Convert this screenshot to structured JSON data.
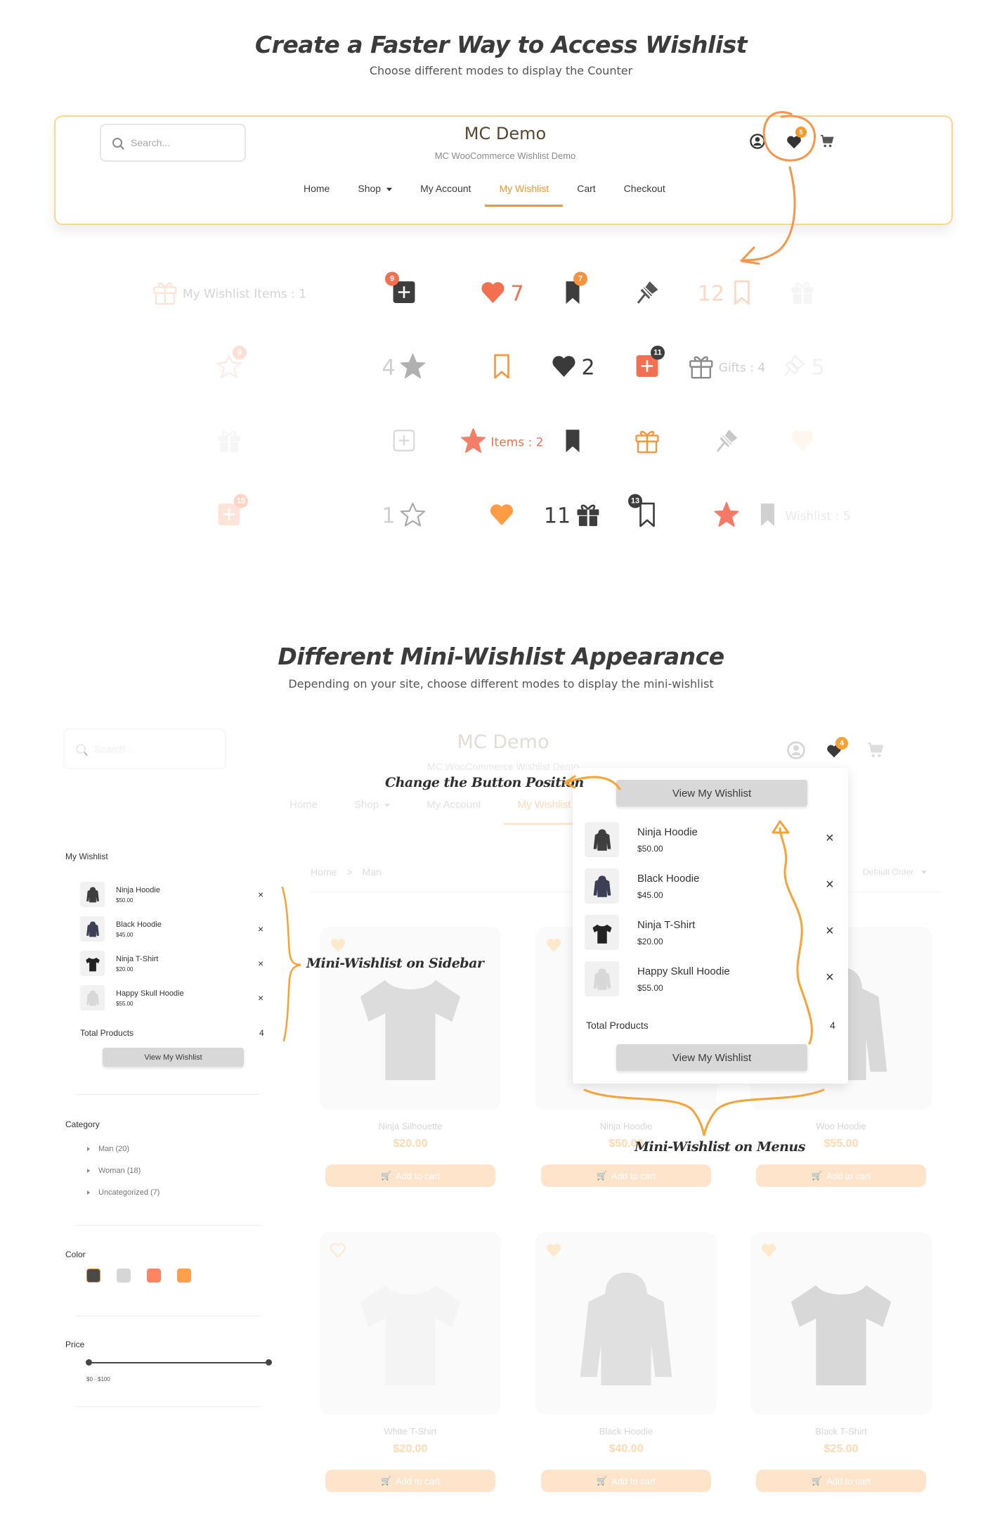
{
  "section1": {
    "title": "Create a Faster Way to Access Wishlist",
    "subtitle": "Choose different modes to display the Counter",
    "header_demo": {
      "search_placeholder": "Search...",
      "brand": "MC Demo",
      "tagline": "MC WooCommerce Wishlist Demo",
      "nav": [
        "Home",
        "Shop",
        "My Account",
        "My Wishlist",
        "Cart",
        "Checkout"
      ],
      "active_nav": "My Wishlist",
      "wishlist_count": "5"
    },
    "counter_examples": [
      {
        "icon": "gift-outline-icon",
        "label": "My Wishlist Items : 1"
      },
      {
        "icon": "plus-square-icon",
        "badge": "9"
      },
      {
        "icon": "heart-icon",
        "count": "7"
      },
      {
        "icon": "bookmark-icon",
        "badge": "7"
      },
      {
        "icon": "pin-icon"
      },
      {
        "icon": "bookmark-outline-icon",
        "count": "12"
      },
      {
        "icon": "gift-icon"
      },
      {
        "icon": "star-outline-icon",
        "badge": "9"
      },
      {
        "icon": "star-icon",
        "count": "4"
      },
      {
        "icon": "bookmark-outline-icon"
      },
      {
        "icon": "heart-icon",
        "count": "2"
      },
      {
        "icon": "plus-square-icon",
        "badge": "11"
      },
      {
        "icon": "gift-outline-icon",
        "label": "Gifts : 4"
      },
      {
        "icon": "pin-outline-icon",
        "count": "5"
      },
      {
        "icon": "gift-icon"
      },
      {
        "icon": "plus-square-outline-icon"
      },
      {
        "icon": "star-icon",
        "label": "Items : 2"
      },
      {
        "icon": "bookmark-icon"
      },
      {
        "icon": "gift-outline-icon"
      },
      {
        "icon": "pin-icon"
      },
      {
        "icon": "heart-icon"
      },
      {
        "icon": "plus-square-icon",
        "badge": "15"
      },
      {
        "icon": "star-outline-icon",
        "count": "1"
      },
      {
        "icon": "heart-icon"
      },
      {
        "icon": "gift-icon",
        "count": "11"
      },
      {
        "icon": "bookmark-outline-icon",
        "badge": "13"
      },
      {
        "icon": "star-icon"
      },
      {
        "icon": "bookmark-icon",
        "label": "Wishlist : 5"
      }
    ]
  },
  "section2": {
    "title": "Different Mini-Wishlist Appearance",
    "subtitle": "Depending on your site, choose different modes to display the mini-wishlist",
    "header_demo": {
      "search_placeholder": "Search...",
      "brand": "MC Demo",
      "tagline": "MC WooCommerce Wishlist Demo",
      "nav": [
        "Home",
        "Shop",
        "My Account",
        "My Wishlist"
      ],
      "wishlist_count": "4"
    },
    "breadcrumb": [
      "Home",
      "Man"
    ],
    "sort_label": "Default Order",
    "annotations": {
      "button_position": "Change the Button Position",
      "sidebar": "Mini-Wishlist on Sidebar",
      "menus": "Mini-Wishlist on Menus"
    },
    "sidebar": {
      "wishlist_title": "My Wishlist",
      "items": [
        {
          "name": "Ninja Hoodie",
          "price": "$50.00"
        },
        {
          "name": "Black Hoodie",
          "price": "$45.00"
        },
        {
          "name": "Ninja T-Shirt",
          "price": "$20.00"
        },
        {
          "name": "Happy Skull Hoodie",
          "price": "$55.00"
        }
      ],
      "total_label": "Total Products",
      "total_value": "4",
      "view_button": "View My Wishlist",
      "category_title": "Category",
      "categories": [
        "Man (20)",
        "Woman (18)",
        "Uncategorized (7)"
      ],
      "color_title": "Color",
      "colors": [
        "#4a4a4a",
        "#d6d6d6",
        "#ff8462",
        "#ffa04f"
      ],
      "price_title": "Price",
      "price_range": "$0 - $100"
    },
    "popup": {
      "top_button": "View My Wishlist",
      "items": [
        {
          "name": "Ninja Hoodie",
          "price": "$50.00"
        },
        {
          "name": "Black Hoodie",
          "price": "$45.00"
        },
        {
          "name": "Ninja T-Shirt",
          "price": "$20.00"
        },
        {
          "name": "Happy Skull Hoodie",
          "price": "$55.00"
        }
      ],
      "total_label": "Total Products",
      "total_value": "4",
      "bottom_button": "View My Wishlist"
    },
    "products": [
      {
        "name": "Ninja Silhouette",
        "price": "$20.00"
      },
      {
        "name": "Ninja Hoodie",
        "price": "$50.00"
      },
      {
        "name": "Woo Hoodie",
        "price": "$55.00"
      },
      {
        "name": "White T-Shirt",
        "price": "$20.00"
      },
      {
        "name": "Black Hoodie",
        "price": "$40.00"
      },
      {
        "name": "Black T-Shirt",
        "price": "$25.00"
      }
    ],
    "add_to_cart": "Add to cart"
  },
  "colors": {
    "accent_orange": "#f0962f",
    "coral": "#f2704f",
    "dark": "#3d3d3d"
  }
}
